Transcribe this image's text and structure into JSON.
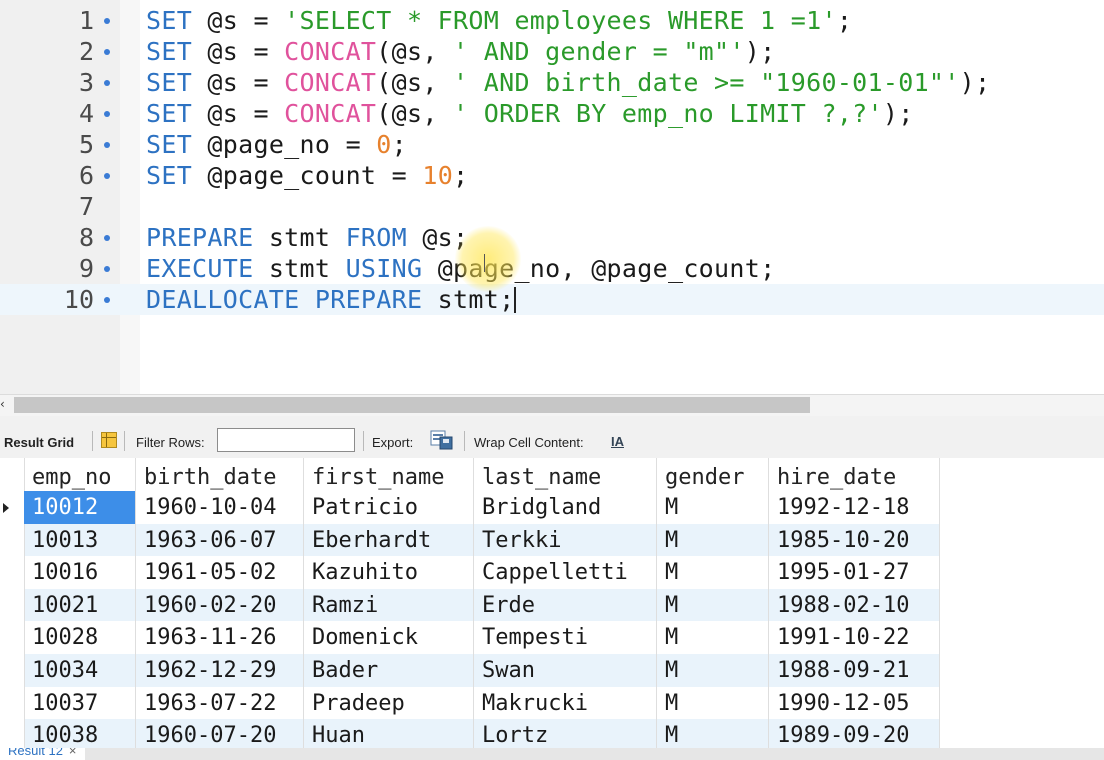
{
  "editor": {
    "lines": [
      {
        "num": "1",
        "segments": [
          {
            "t": "SET",
            "c": "kw"
          },
          {
            "t": " @s = ",
            "c": ""
          },
          {
            "t": "'SELECT * FROM employees WHERE 1 =1'",
            "c": "str"
          },
          {
            "t": ";",
            "c": ""
          }
        ]
      },
      {
        "num": "2",
        "segments": [
          {
            "t": "SET",
            "c": "kw"
          },
          {
            "t": " @s = ",
            "c": ""
          },
          {
            "t": "CONCAT",
            "c": "fn"
          },
          {
            "t": "(@s, ",
            "c": ""
          },
          {
            "t": "' AND gender = \"m\"'",
            "c": "str"
          },
          {
            "t": ");",
            "c": ""
          }
        ]
      },
      {
        "num": "3",
        "segments": [
          {
            "t": "SET",
            "c": "kw"
          },
          {
            "t": " @s = ",
            "c": ""
          },
          {
            "t": "CONCAT",
            "c": "fn"
          },
          {
            "t": "(@s, ",
            "c": ""
          },
          {
            "t": "' AND birth_date >= \"1960-01-01\"'",
            "c": "str"
          },
          {
            "t": ");",
            "c": ""
          }
        ]
      },
      {
        "num": "4",
        "segments": [
          {
            "t": "SET",
            "c": "kw"
          },
          {
            "t": " @s = ",
            "c": ""
          },
          {
            "t": "CONCAT",
            "c": "fn"
          },
          {
            "t": "(@s, ",
            "c": ""
          },
          {
            "t": "' ORDER BY emp_no LIMIT ?,?'",
            "c": "str"
          },
          {
            "t": ");",
            "c": ""
          }
        ]
      },
      {
        "num": "5",
        "segments": [
          {
            "t": "SET",
            "c": "kw"
          },
          {
            "t": " @page_no = ",
            "c": ""
          },
          {
            "t": "0",
            "c": "num"
          },
          {
            "t": ";",
            "c": ""
          }
        ]
      },
      {
        "num": "6",
        "segments": [
          {
            "t": "SET",
            "c": "kw"
          },
          {
            "t": " @page_count = ",
            "c": ""
          },
          {
            "t": "10",
            "c": "num"
          },
          {
            "t": ";",
            "c": ""
          }
        ]
      },
      {
        "num": "7",
        "segments": []
      },
      {
        "num": "8",
        "segments": [
          {
            "t": "PREPARE",
            "c": "kw"
          },
          {
            "t": " stmt ",
            "c": ""
          },
          {
            "t": "FROM",
            "c": "kw"
          },
          {
            "t": " @s;",
            "c": ""
          }
        ]
      },
      {
        "num": "9",
        "segments": [
          {
            "t": "EXECUTE",
            "c": "kw"
          },
          {
            "t": " stmt ",
            "c": ""
          },
          {
            "t": "USING",
            "c": "kw"
          },
          {
            "t": " @page_no, @page_count;",
            "c": ""
          }
        ]
      },
      {
        "num": "10",
        "segments": [
          {
            "t": "DEALLOCATE PREPARE",
            "c": "kw"
          },
          {
            "t": " stmt;",
            "c": ""
          }
        ]
      }
    ],
    "breakpoint_lines": [
      "1",
      "2",
      "3",
      "4",
      "5",
      "6",
      "8",
      "9",
      "10"
    ],
    "current_line": "10"
  },
  "toolbar": {
    "result_grid_label": "Result Grid",
    "filter_rows_label": "Filter Rows:",
    "filter_rows_value": "",
    "export_label": "Export:",
    "wrap_label": "Wrap Cell Content:",
    "wrap_icon": "IA"
  },
  "grid": {
    "columns": [
      "emp_no",
      "birth_date",
      "first_name",
      "last_name",
      "gender",
      "hire_date"
    ],
    "rows": [
      [
        "10012",
        "1960-10-04",
        "Patricio",
        "Bridgland",
        "M",
        "1992-12-18"
      ],
      [
        "10013",
        "1963-06-07",
        "Eberhardt",
        "Terkki",
        "M",
        "1985-10-20"
      ],
      [
        "10016",
        "1961-05-02",
        "Kazuhito",
        "Cappelletti",
        "M",
        "1995-01-27"
      ],
      [
        "10021",
        "1960-02-20",
        "Ramzi",
        "Erde",
        "M",
        "1988-02-10"
      ],
      [
        "10028",
        "1963-11-26",
        "Domenick",
        "Tempesti",
        "M",
        "1991-10-22"
      ],
      [
        "10034",
        "1962-12-29",
        "Bader",
        "Swan",
        "M",
        "1988-09-21"
      ],
      [
        "10037",
        "1963-07-22",
        "Pradeep",
        "Makrucki",
        "M",
        "1990-12-05"
      ],
      [
        "10038",
        "1960-07-20",
        "Huan",
        "Lortz",
        "M",
        "1989-09-20"
      ]
    ],
    "selected_row": 0,
    "selected_col": 0
  },
  "tabs": {
    "result_tab_label": "Result 12",
    "close_glyph": "×"
  },
  "colors": {
    "keyword": "#2d72c2",
    "function": "#e0529c",
    "string": "#2a9a2a",
    "number": "#e7812d",
    "selection": "#3d8ee8"
  }
}
